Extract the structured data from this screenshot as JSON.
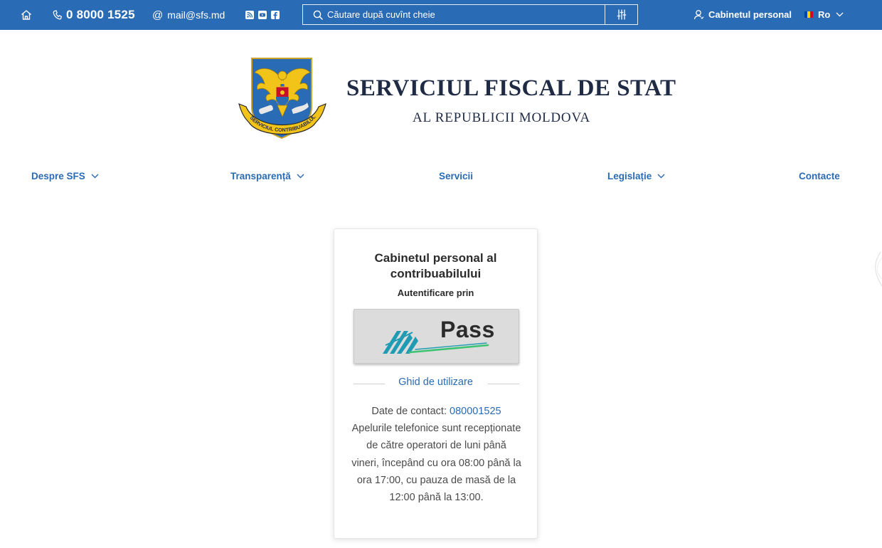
{
  "topbar": {
    "phone": "0 8000 1525",
    "email": "mail@sfs.md",
    "social_icons": [
      "rss-icon",
      "youtube-icon",
      "facebook-icon"
    ],
    "search_placeholder": "Căutare după cuvînt cheie",
    "cabinet_label": "Cabinetul personal",
    "language": "Ro"
  },
  "header": {
    "emblem_ribbon_text": "ÎN SERVICIUL CONTRIBUABILULUI",
    "title": "SERVICIUL FISCAL DE STAT",
    "subtitle": "AL REPUBLICII MOLDOVA"
  },
  "nav": {
    "items": [
      {
        "label": "Despre SFS",
        "dropdown": true
      },
      {
        "label": "Transparență",
        "dropdown": true
      },
      {
        "label": "Servicii",
        "dropdown": false
      },
      {
        "label": "Legislație",
        "dropdown": true
      },
      {
        "label": "Contacte",
        "dropdown": false
      }
    ]
  },
  "card": {
    "title": "Cabinetul personal al contribuabilului",
    "auth_label": "Autentificare prin",
    "mpass_label": "Pass",
    "guide_link": "Ghid de utilizare",
    "contact_prefix": "Date de contact:",
    "contact_phone": "080001525",
    "contact_note": "Apelurile telefonice sunt recepționate de către operatori de luni până vineri, începând cu ora 08:00 până la ora 17:00, cu pauza de masă de la 12:00 până la 13:00."
  },
  "colors": {
    "topbar_bg": "#2a6bb5",
    "link_blue": "#2a6bb5",
    "title_navy": "#1f2b45",
    "mpass_teal": "#1f9cb3",
    "mpass_green": "#3cc473"
  }
}
